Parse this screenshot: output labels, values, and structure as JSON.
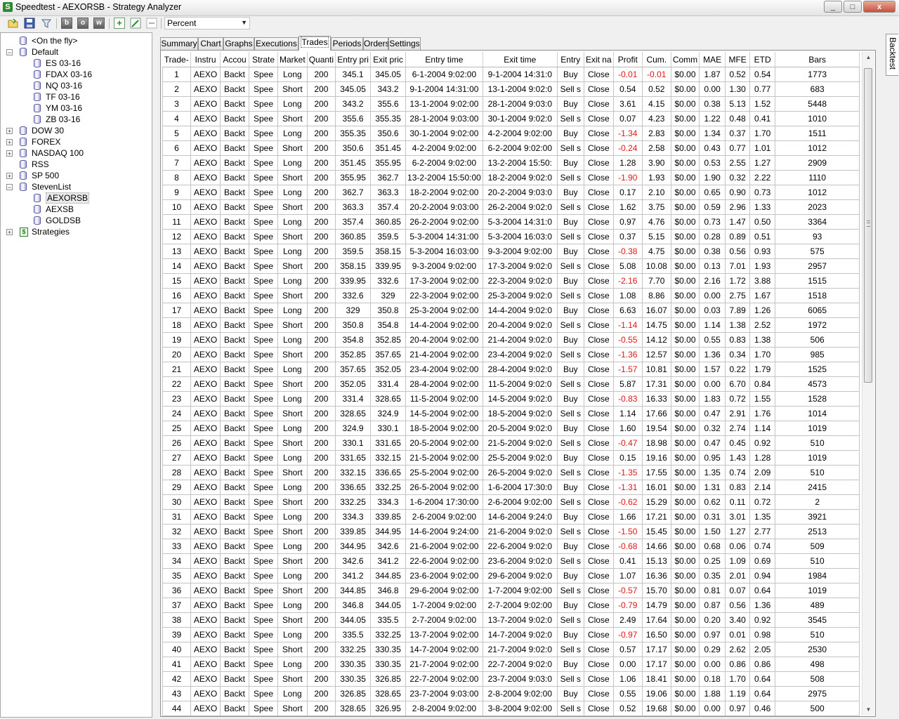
{
  "window": {
    "title": "Speedtest - AEXORSB - Strategy Analyzer",
    "controls": {
      "minimize": "_",
      "maximize": "□",
      "close": "x"
    }
  },
  "toolbar": {
    "buttons": [
      {
        "name": "open-folder-icon"
      },
      {
        "name": "save-icon"
      },
      {
        "name": "filter-icon"
      },
      {
        "name": "bold-b-icon",
        "glyph": "b"
      },
      {
        "name": "bold-o-icon",
        "glyph": "o"
      },
      {
        "name": "bold-w-icon",
        "glyph": "w"
      },
      {
        "name": "add-icon",
        "glyph": "+"
      },
      {
        "name": "edit-icon"
      },
      {
        "name": "remove-icon"
      }
    ],
    "dropdown": {
      "value": "Percent"
    }
  },
  "tree": {
    "items": [
      {
        "label": "<On the fly>",
        "level": 1,
        "expander": "",
        "icon": "db"
      },
      {
        "label": "Default",
        "level": 0,
        "expander": "−",
        "icon": "db"
      },
      {
        "label": "ES 03-16",
        "level": 2,
        "expander": "",
        "icon": "db"
      },
      {
        "label": "FDAX 03-16",
        "level": 2,
        "expander": "",
        "icon": "db"
      },
      {
        "label": "NQ 03-16",
        "level": 2,
        "expander": "",
        "icon": "db"
      },
      {
        "label": "TF 03-16",
        "level": 2,
        "expander": "",
        "icon": "db"
      },
      {
        "label": "YM 03-16",
        "level": 2,
        "expander": "",
        "icon": "db"
      },
      {
        "label": "ZB 03-16",
        "level": 2,
        "expander": "",
        "icon": "db"
      },
      {
        "label": "DOW 30",
        "level": 0,
        "expander": "+",
        "icon": "db"
      },
      {
        "label": "FOREX",
        "level": 0,
        "expander": "+",
        "icon": "db"
      },
      {
        "label": "NASDAQ 100",
        "level": 0,
        "expander": "+",
        "icon": "db"
      },
      {
        "label": "RSS",
        "level": 1,
        "expander": "",
        "icon": "db"
      },
      {
        "label": "SP 500",
        "level": 0,
        "expander": "+",
        "icon": "db"
      },
      {
        "label": "StevenList",
        "level": 0,
        "expander": "−",
        "icon": "db"
      },
      {
        "label": "AEXORSB",
        "level": 2,
        "expander": "",
        "icon": "db",
        "selected": true
      },
      {
        "label": "AEXSB",
        "level": 2,
        "expander": "",
        "icon": "db"
      },
      {
        "label": "GOLDSB",
        "level": 2,
        "expander": "",
        "icon": "db"
      },
      {
        "label": "Strategies",
        "level": 0,
        "expander": "+",
        "icon": "strategy"
      }
    ]
  },
  "tabs": [
    {
      "label": "Summary"
    },
    {
      "label": "Chart"
    },
    {
      "label": "Graphs"
    },
    {
      "label": "Executions"
    },
    {
      "label": "Trades",
      "active": true
    },
    {
      "label": "Periods"
    },
    {
      "label": "Orders"
    },
    {
      "label": "Settings"
    }
  ],
  "side_panel": {
    "label": "Backtest"
  },
  "trades": {
    "columns": [
      "Trade-",
      "Instru",
      "Accou",
      "Strate",
      "Market",
      "Quanti",
      "Entry pri",
      "Exit pric",
      "Entry time",
      "Exit time",
      "Entry",
      "Exit na",
      "Profit",
      "Cum.",
      "Comm",
      "MAE",
      "MFE",
      "ETD",
      "Bars"
    ],
    "rows": [
      [
        "1",
        "AEXO",
        "Backt",
        "Spee",
        "Long",
        "200",
        "345.1",
        "345.05",
        "6-1-2004 9:02:00",
        "9-1-2004 14:31:0",
        "Buy",
        "Close",
        "-0.01",
        "-0.01",
        "$0.00",
        "1.87",
        "0.52",
        "0.54",
        "1773"
      ],
      [
        "2",
        "AEXO",
        "Backt",
        "Spee",
        "Short",
        "200",
        "345.05",
        "343.2",
        "9-1-2004 14:31:00",
        "13-1-2004 9:02:0",
        "Sell s",
        "Close",
        "0.54",
        "0.52",
        "$0.00",
        "0.00",
        "1.30",
        "0.77",
        "683"
      ],
      [
        "3",
        "AEXO",
        "Backt",
        "Spee",
        "Long",
        "200",
        "343.2",
        "355.6",
        "13-1-2004 9:02:00",
        "28-1-2004 9:03:0",
        "Buy",
        "Close",
        "3.61",
        "4.15",
        "$0.00",
        "0.38",
        "5.13",
        "1.52",
        "5448"
      ],
      [
        "4",
        "AEXO",
        "Backt",
        "Spee",
        "Short",
        "200",
        "355.6",
        "355.35",
        "28-1-2004 9:03:00",
        "30-1-2004 9:02:0",
        "Sell s",
        "Close",
        "0.07",
        "4.23",
        "$0.00",
        "1.22",
        "0.48",
        "0.41",
        "1010"
      ],
      [
        "5",
        "AEXO",
        "Backt",
        "Spee",
        "Long",
        "200",
        "355.35",
        "350.6",
        "30-1-2004 9:02:00",
        "4-2-2004 9:02:00",
        "Buy",
        "Close",
        "-1.34",
        "2.83",
        "$0.00",
        "1.34",
        "0.37",
        "1.70",
        "1511"
      ],
      [
        "6",
        "AEXO",
        "Backt",
        "Spee",
        "Short",
        "200",
        "350.6",
        "351.45",
        "4-2-2004 9:02:00",
        "6-2-2004 9:02:00",
        "Sell s",
        "Close",
        "-0.24",
        "2.58",
        "$0.00",
        "0.43",
        "0.77",
        "1.01",
        "1012"
      ],
      [
        "7",
        "AEXO",
        "Backt",
        "Spee",
        "Long",
        "200",
        "351.45",
        "355.95",
        "6-2-2004 9:02:00",
        "13-2-2004 15:50:",
        "Buy",
        "Close",
        "1.28",
        "3.90",
        "$0.00",
        "0.53",
        "2.55",
        "1.27",
        "2909"
      ],
      [
        "8",
        "AEXO",
        "Backt",
        "Spee",
        "Short",
        "200",
        "355.95",
        "362.7",
        "13-2-2004 15:50:00",
        "18-2-2004 9:02:0",
        "Sell s",
        "Close",
        "-1.90",
        "1.93",
        "$0.00",
        "1.90",
        "0.32",
        "2.22",
        "1110"
      ],
      [
        "9",
        "AEXO",
        "Backt",
        "Spee",
        "Long",
        "200",
        "362.7",
        "363.3",
        "18-2-2004 9:02:00",
        "20-2-2004 9:03:0",
        "Buy",
        "Close",
        "0.17",
        "2.10",
        "$0.00",
        "0.65",
        "0.90",
        "0.73",
        "1012"
      ],
      [
        "10",
        "AEXO",
        "Backt",
        "Spee",
        "Short",
        "200",
        "363.3",
        "357.4",
        "20-2-2004 9:03:00",
        "26-2-2004 9:02:0",
        "Sell s",
        "Close",
        "1.62",
        "3.75",
        "$0.00",
        "0.59",
        "2.96",
        "1.33",
        "2023"
      ],
      [
        "11",
        "AEXO",
        "Backt",
        "Spee",
        "Long",
        "200",
        "357.4",
        "360.85",
        "26-2-2004 9:02:00",
        "5-3-2004 14:31:0",
        "Buy",
        "Close",
        "0.97",
        "4.76",
        "$0.00",
        "0.73",
        "1.47",
        "0.50",
        "3364"
      ],
      [
        "12",
        "AEXO",
        "Backt",
        "Spee",
        "Short",
        "200",
        "360.85",
        "359.5",
        "5-3-2004 14:31:00",
        "5-3-2004 16:03:0",
        "Sell s",
        "Close",
        "0.37",
        "5.15",
        "$0.00",
        "0.28",
        "0.89",
        "0.51",
        "93"
      ],
      [
        "13",
        "AEXO",
        "Backt",
        "Spee",
        "Long",
        "200",
        "359.5",
        "358.15",
        "5-3-2004 16:03:00",
        "9-3-2004 9:02:00",
        "Buy",
        "Close",
        "-0.38",
        "4.75",
        "$0.00",
        "0.38",
        "0.56",
        "0.93",
        "575"
      ],
      [
        "14",
        "AEXO",
        "Backt",
        "Spee",
        "Short",
        "200",
        "358.15",
        "339.95",
        "9-3-2004 9:02:00",
        "17-3-2004 9:02:0",
        "Sell s",
        "Close",
        "5.08",
        "10.08",
        "$0.00",
        "0.13",
        "7.01",
        "1.93",
        "2957"
      ],
      [
        "15",
        "AEXO",
        "Backt",
        "Spee",
        "Long",
        "200",
        "339.95",
        "332.6",
        "17-3-2004 9:02:00",
        "22-3-2004 9:02:0",
        "Buy",
        "Close",
        "-2.16",
        "7.70",
        "$0.00",
        "2.16",
        "1.72",
        "3.88",
        "1515"
      ],
      [
        "16",
        "AEXO",
        "Backt",
        "Spee",
        "Short",
        "200",
        "332.6",
        "329",
        "22-3-2004 9:02:00",
        "25-3-2004 9:02:0",
        "Sell s",
        "Close",
        "1.08",
        "8.86",
        "$0.00",
        "0.00",
        "2.75",
        "1.67",
        "1518"
      ],
      [
        "17",
        "AEXO",
        "Backt",
        "Spee",
        "Long",
        "200",
        "329",
        "350.8",
        "25-3-2004 9:02:00",
        "14-4-2004 9:02:0",
        "Buy",
        "Close",
        "6.63",
        "16.07",
        "$0.00",
        "0.03",
        "7.89",
        "1.26",
        "6065"
      ],
      [
        "18",
        "AEXO",
        "Backt",
        "Spee",
        "Short",
        "200",
        "350.8",
        "354.8",
        "14-4-2004 9:02:00",
        "20-4-2004 9:02:0",
        "Sell s",
        "Close",
        "-1.14",
        "14.75",
        "$0.00",
        "1.14",
        "1.38",
        "2.52",
        "1972"
      ],
      [
        "19",
        "AEXO",
        "Backt",
        "Spee",
        "Long",
        "200",
        "354.8",
        "352.85",
        "20-4-2004 9:02:00",
        "21-4-2004 9:02:0",
        "Buy",
        "Close",
        "-0.55",
        "14.12",
        "$0.00",
        "0.55",
        "0.83",
        "1.38",
        "506"
      ],
      [
        "20",
        "AEXO",
        "Backt",
        "Spee",
        "Short",
        "200",
        "352.85",
        "357.65",
        "21-4-2004 9:02:00",
        "23-4-2004 9:02:0",
        "Sell s",
        "Close",
        "-1.36",
        "12.57",
        "$0.00",
        "1.36",
        "0.34",
        "1.70",
        "985"
      ],
      [
        "21",
        "AEXO",
        "Backt",
        "Spee",
        "Long",
        "200",
        "357.65",
        "352.05",
        "23-4-2004 9:02:00",
        "28-4-2004 9:02:0",
        "Buy",
        "Close",
        "-1.57",
        "10.81",
        "$0.00",
        "1.57",
        "0.22",
        "1.79",
        "1525"
      ],
      [
        "22",
        "AEXO",
        "Backt",
        "Spee",
        "Short",
        "200",
        "352.05",
        "331.4",
        "28-4-2004 9:02:00",
        "11-5-2004 9:02:0",
        "Sell s",
        "Close",
        "5.87",
        "17.31",
        "$0.00",
        "0.00",
        "6.70",
        "0.84",
        "4573"
      ],
      [
        "23",
        "AEXO",
        "Backt",
        "Spee",
        "Long",
        "200",
        "331.4",
        "328.65",
        "11-5-2004 9:02:00",
        "14-5-2004 9:02:0",
        "Buy",
        "Close",
        "-0.83",
        "16.33",
        "$0.00",
        "1.83",
        "0.72",
        "1.55",
        "1528"
      ],
      [
        "24",
        "AEXO",
        "Backt",
        "Spee",
        "Short",
        "200",
        "328.65",
        "324.9",
        "14-5-2004 9:02:00",
        "18-5-2004 9:02:0",
        "Sell s",
        "Close",
        "1.14",
        "17.66",
        "$0.00",
        "0.47",
        "2.91",
        "1.76",
        "1014"
      ],
      [
        "25",
        "AEXO",
        "Backt",
        "Spee",
        "Long",
        "200",
        "324.9",
        "330.1",
        "18-5-2004 9:02:00",
        "20-5-2004 9:02:0",
        "Buy",
        "Close",
        "1.60",
        "19.54",
        "$0.00",
        "0.32",
        "2.74",
        "1.14",
        "1019"
      ],
      [
        "26",
        "AEXO",
        "Backt",
        "Spee",
        "Short",
        "200",
        "330.1",
        "331.65",
        "20-5-2004 9:02:00",
        "21-5-2004 9:02:0",
        "Sell s",
        "Close",
        "-0.47",
        "18.98",
        "$0.00",
        "0.47",
        "0.45",
        "0.92",
        "510"
      ],
      [
        "27",
        "AEXO",
        "Backt",
        "Spee",
        "Long",
        "200",
        "331.65",
        "332.15",
        "21-5-2004 9:02:00",
        "25-5-2004 9:02:0",
        "Buy",
        "Close",
        "0.15",
        "19.16",
        "$0.00",
        "0.95",
        "1.43",
        "1.28",
        "1019"
      ],
      [
        "28",
        "AEXO",
        "Backt",
        "Spee",
        "Short",
        "200",
        "332.15",
        "336.65",
        "25-5-2004 9:02:00",
        "26-5-2004 9:02:0",
        "Sell s",
        "Close",
        "-1.35",
        "17.55",
        "$0.00",
        "1.35",
        "0.74",
        "2.09",
        "510"
      ],
      [
        "29",
        "AEXO",
        "Backt",
        "Spee",
        "Long",
        "200",
        "336.65",
        "332.25",
        "26-5-2004 9:02:00",
        "1-6-2004 17:30:0",
        "Buy",
        "Close",
        "-1.31",
        "16.01",
        "$0.00",
        "1.31",
        "0.83",
        "2.14",
        "2415"
      ],
      [
        "30",
        "AEXO",
        "Backt",
        "Spee",
        "Short",
        "200",
        "332.25",
        "334.3",
        "1-6-2004 17:30:00",
        "2-6-2004 9:02:00",
        "Sell s",
        "Close",
        "-0.62",
        "15.29",
        "$0.00",
        "0.62",
        "0.11",
        "0.72",
        "2"
      ],
      [
        "31",
        "AEXO",
        "Backt",
        "Spee",
        "Long",
        "200",
        "334.3",
        "339.85",
        "2-6-2004 9:02:00",
        "14-6-2004 9:24:0",
        "Buy",
        "Close",
        "1.66",
        "17.21",
        "$0.00",
        "0.31",
        "3.01",
        "1.35",
        "3921"
      ],
      [
        "32",
        "AEXO",
        "Backt",
        "Spee",
        "Short",
        "200",
        "339.85",
        "344.95",
        "14-6-2004 9:24:00",
        "21-6-2004 9:02:0",
        "Sell s",
        "Close",
        "-1.50",
        "15.45",
        "$0.00",
        "1.50",
        "1.27",
        "2.77",
        "2513"
      ],
      [
        "33",
        "AEXO",
        "Backt",
        "Spee",
        "Long",
        "200",
        "344.95",
        "342.6",
        "21-6-2004 9:02:00",
        "22-6-2004 9:02:0",
        "Buy",
        "Close",
        "-0.68",
        "14.66",
        "$0.00",
        "0.68",
        "0.06",
        "0.74",
        "509"
      ],
      [
        "34",
        "AEXO",
        "Backt",
        "Spee",
        "Short",
        "200",
        "342.6",
        "341.2",
        "22-6-2004 9:02:00",
        "23-6-2004 9:02:0",
        "Sell s",
        "Close",
        "0.41",
        "15.13",
        "$0.00",
        "0.25",
        "1.09",
        "0.69",
        "510"
      ],
      [
        "35",
        "AEXO",
        "Backt",
        "Spee",
        "Long",
        "200",
        "341.2",
        "344.85",
        "23-6-2004 9:02:00",
        "29-6-2004 9:02:0",
        "Buy",
        "Close",
        "1.07",
        "16.36",
        "$0.00",
        "0.35",
        "2.01",
        "0.94",
        "1984"
      ],
      [
        "36",
        "AEXO",
        "Backt",
        "Spee",
        "Short",
        "200",
        "344.85",
        "346.8",
        "29-6-2004 9:02:00",
        "1-7-2004 9:02:00",
        "Sell s",
        "Close",
        "-0.57",
        "15.70",
        "$0.00",
        "0.81",
        "0.07",
        "0.64",
        "1019"
      ],
      [
        "37",
        "AEXO",
        "Backt",
        "Spee",
        "Long",
        "200",
        "346.8",
        "344.05",
        "1-7-2004 9:02:00",
        "2-7-2004 9:02:00",
        "Buy",
        "Close",
        "-0.79",
        "14.79",
        "$0.00",
        "0.87",
        "0.56",
        "1.36",
        "489"
      ],
      [
        "38",
        "AEXO",
        "Backt",
        "Spee",
        "Short",
        "200",
        "344.05",
        "335.5",
        "2-7-2004 9:02:00",
        "13-7-2004 9:02:0",
        "Sell s",
        "Close",
        "2.49",
        "17.64",
        "$0.00",
        "0.20",
        "3.40",
        "0.92",
        "3545"
      ],
      [
        "39",
        "AEXO",
        "Backt",
        "Spee",
        "Long",
        "200",
        "335.5",
        "332.25",
        "13-7-2004 9:02:00",
        "14-7-2004 9:02:0",
        "Buy",
        "Close",
        "-0.97",
        "16.50",
        "$0.00",
        "0.97",
        "0.01",
        "0.98",
        "510"
      ],
      [
        "40",
        "AEXO",
        "Backt",
        "Spee",
        "Short",
        "200",
        "332.25",
        "330.35",
        "14-7-2004 9:02:00",
        "21-7-2004 9:02:0",
        "Sell s",
        "Close",
        "0.57",
        "17.17",
        "$0.00",
        "0.29",
        "2.62",
        "2.05",
        "2530"
      ],
      [
        "41",
        "AEXO",
        "Backt",
        "Spee",
        "Long",
        "200",
        "330.35",
        "330.35",
        "21-7-2004 9:02:00",
        "22-7-2004 9:02:0",
        "Buy",
        "Close",
        "0.00",
        "17.17",
        "$0.00",
        "0.00",
        "0.86",
        "0.86",
        "498"
      ],
      [
        "42",
        "AEXO",
        "Backt",
        "Spee",
        "Short",
        "200",
        "330.35",
        "326.85",
        "22-7-2004 9:02:00",
        "23-7-2004 9:03:0",
        "Sell s",
        "Close",
        "1.06",
        "18.41",
        "$0.00",
        "0.18",
        "1.70",
        "0.64",
        "508"
      ],
      [
        "43",
        "AEXO",
        "Backt",
        "Spee",
        "Long",
        "200",
        "326.85",
        "328.65",
        "23-7-2004 9:03:00",
        "2-8-2004 9:02:00",
        "Buy",
        "Close",
        "0.55",
        "19.06",
        "$0.00",
        "1.88",
        "1.19",
        "0.64",
        "2975"
      ],
      [
        "44",
        "AEXO",
        "Backt",
        "Spee",
        "Short",
        "200",
        "328.65",
        "326.95",
        "2-8-2004 9:02:00",
        "3-8-2004 9:02:00",
        "Sell s",
        "Close",
        "0.52",
        "19.68",
        "$0.00",
        "0.00",
        "0.97",
        "0.46",
        "500"
      ]
    ]
  },
  "colors": {
    "negative": "#e01818",
    "selection": "#e9e9e9"
  }
}
